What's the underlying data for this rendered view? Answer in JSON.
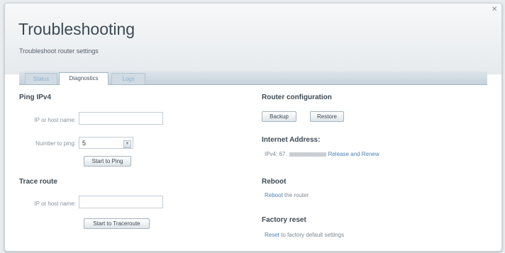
{
  "header": {
    "title": "Troubleshooting",
    "subtitle": "Troubleshoot router settings"
  },
  "tabs": [
    {
      "label": "Status",
      "active": false
    },
    {
      "label": "Diagnostics",
      "active": true
    },
    {
      "label": "Logs",
      "active": false
    }
  ],
  "ping": {
    "heading": "Ping IPv4",
    "ip_label": "IP or host name:",
    "ip_value": "",
    "number_label": "Number to ping:",
    "number_value": "5",
    "start_button": "Start to Ping"
  },
  "trace": {
    "heading": "Trace route",
    "ip_label": "IP or host name:",
    "ip_value": "",
    "start_button": "Start to Traceroute"
  },
  "router_config": {
    "heading": "Router configuration",
    "backup_button": "Backup",
    "restore_button": "Restore"
  },
  "internet_address": {
    "heading": "Internet Address:",
    "ipv4_prefix": "IPv4: 67.",
    "release_renew_link": "Release and Renew"
  },
  "reboot": {
    "heading": "Reboot",
    "link": "Reboot",
    "text": " the router"
  },
  "factory_reset": {
    "heading": "Factory reset",
    "link": "Reset",
    "text": " to factory default settings"
  },
  "colors": {
    "link": "#4a83b8",
    "heading": "#3f4a54",
    "tab_inactive_text": "#8ab3d2"
  }
}
